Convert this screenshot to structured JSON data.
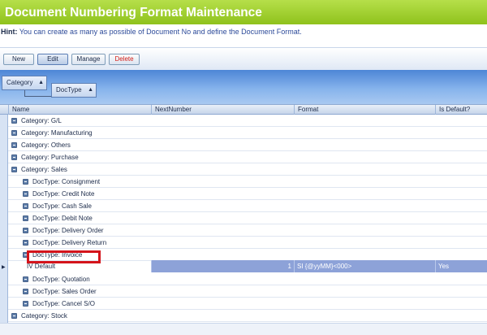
{
  "title": "Document Numbering Format Maintenance",
  "hint": {
    "label": "Hint:",
    "text": "You can create as many as possible of Document No and define the Document Format."
  },
  "toolbar": {
    "new": "New",
    "edit": "Edit",
    "manage": "Manage",
    "delete": "Delete"
  },
  "groupby": {
    "chip1": "Category",
    "chip2": "DocType"
  },
  "columns": [
    "Name",
    "NextNumber",
    "Format",
    "Is Default?"
  ],
  "rows": [
    "Category: G/L",
    "Category: Manufacturing",
    "Category: Others",
    "Category: Purchase",
    "Category: Sales",
    "DocType: Consignment",
    "DocType: Credit Note",
    "DocType: Cash Sale",
    "DocType: Debit Note",
    "DocType: Delivery Order",
    "DocType: Delivery Return",
    "DocType: Invoice",
    "",
    "DocType: Quotation",
    "DocType: Sales Order",
    "DocType: Cancel S/O",
    "Category: Stock"
  ],
  "data_row": {
    "name": "IV Default",
    "next_number": "1",
    "format": "SI {@yyMM}<000>",
    "is_default": "Yes"
  },
  "accent": {
    "title_green": "#8fc21c",
    "selection": "#8da2d8",
    "highlight": "#d4141b"
  }
}
